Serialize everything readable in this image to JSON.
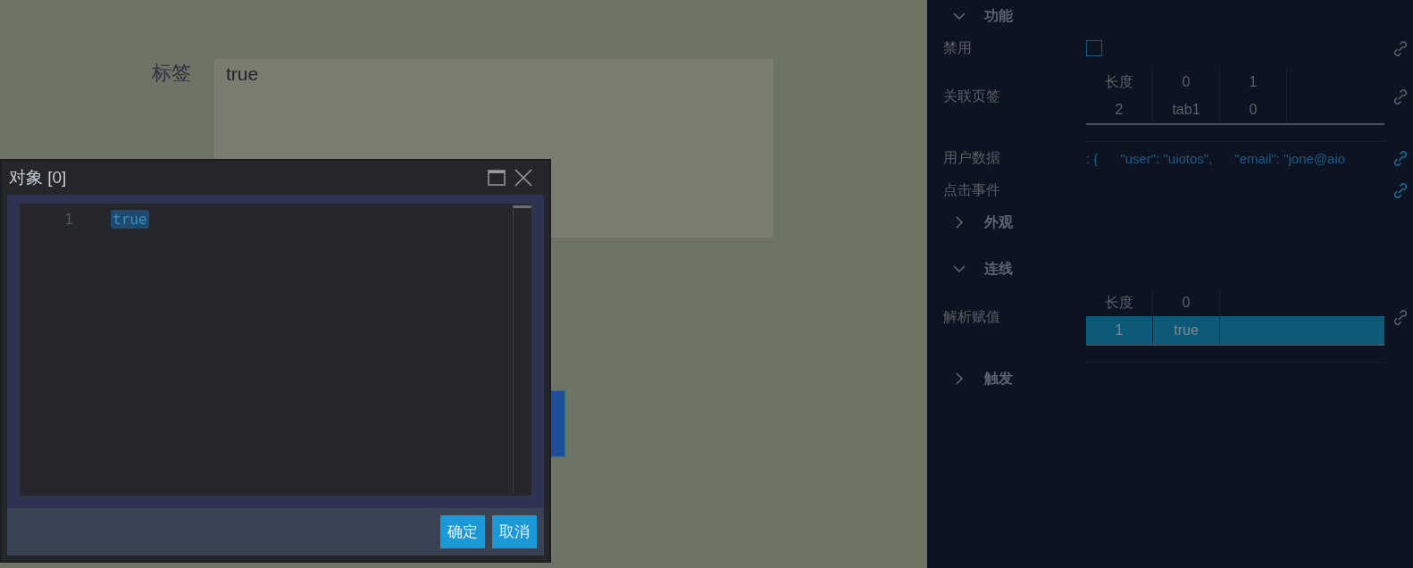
{
  "canvas": {
    "field": {
      "label": "标签",
      "value": "true"
    }
  },
  "dialog": {
    "title": "对象 [0]",
    "editor": {
      "lines": [
        {
          "number": "1",
          "code": "true",
          "selected": true
        }
      ]
    },
    "buttons": [
      "确定",
      "取消"
    ]
  },
  "panel": {
    "sections": [
      {
        "title": "功能",
        "expanded": true,
        "rows": [
          {
            "kind": "checkbox",
            "label": "禁用",
            "checked": false,
            "bound": false
          },
          {
            "kind": "table",
            "label": "关联页签",
            "header": [
              "长度",
              "0",
              "1"
            ],
            "rows": [
              {
                "cells": [
                  "2",
                  "tab1",
                  "0"
                ],
                "selected": false
              }
            ],
            "bound": false
          },
          {
            "kind": "text",
            "label": "用户数据",
            "value": ": {      \"user\": \"uiotos\",      \"email\": \"jone@aio",
            "bound": true
          },
          {
            "kind": "text",
            "label": "点击事件",
            "bound": true
          }
        ]
      },
      {
        "title": "外观",
        "expanded": false
      },
      {
        "title": "连线",
        "expanded": true,
        "rows": [
          {
            "kind": "table",
            "label": "解析赋值",
            "header": [
              "长度",
              "0"
            ],
            "rows": [
              {
                "cells": [
                  "1",
                  "true"
                ],
                "selected": true
              }
            ],
            "bound": false
          }
        ]
      },
      {
        "title": "触发",
        "expanded": false
      }
    ]
  }
}
